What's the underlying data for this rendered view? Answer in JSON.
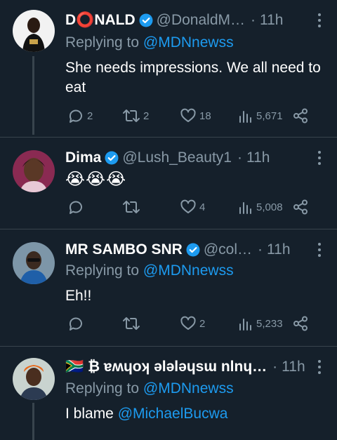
{
  "colors": {
    "background": "#15202b",
    "secondary": "#8899a6",
    "link": "#1d9bf0",
    "divider": "#38444d",
    "verified": "#1d9bf0"
  },
  "replying_label": "Replying to",
  "tweets": [
    {
      "name": "D⭕NALD",
      "handle": "@DonaldM…",
      "time": "11h",
      "reply_to": "@MDNnewss",
      "text": "She needs impressions. We all need to eat",
      "replies": "2",
      "retweets": "2",
      "likes": "18",
      "views": "5,671"
    },
    {
      "name": "Dima",
      "handle": "@Lush_Beauty1",
      "time": "11h",
      "text": "😭😭😭",
      "replies": "",
      "retweets": "",
      "likes": "4",
      "views": "5,008"
    },
    {
      "name": "MR SAMBO SNR",
      "handle": "@col…",
      "time": "11h",
      "reply_to": "@MDNnewss",
      "text": "Eh!!",
      "replies": "",
      "retweets": "",
      "likes": "2",
      "views": "5,233"
    },
    {
      "name": "🇿🇦 ₿ ɐʍɥoʞ ǝlǝlǝɥsɯ nlnɥ…",
      "time": "11h",
      "reply_to": "@MDNnewss",
      "text_prefix": "I blame ",
      "text_mention": "@MichaelBucwa"
    }
  ]
}
